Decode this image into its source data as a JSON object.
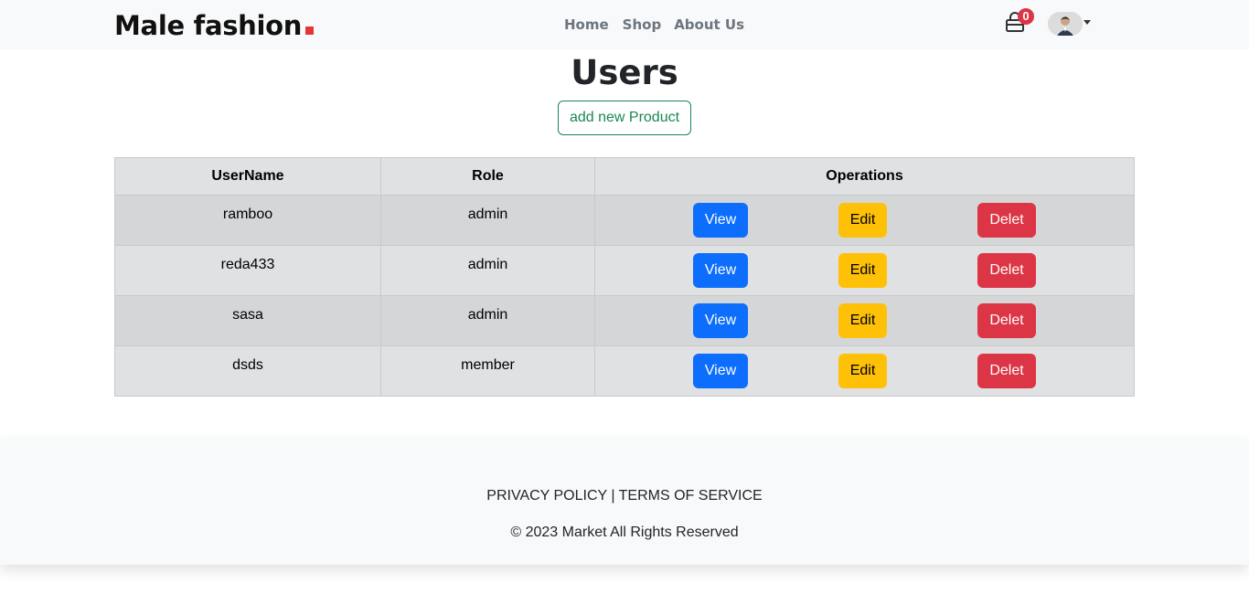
{
  "navbar": {
    "brand": "Male fashion",
    "links": [
      "Home",
      "Shop",
      "About Us"
    ],
    "cart_count": "0",
    "colors": {
      "accent": "#e53637",
      "badge": "#dc3545"
    }
  },
  "page": {
    "title": "Users",
    "add_button": "add new Product"
  },
  "table": {
    "headers": [
      "UserName",
      "Role",
      "Operations"
    ],
    "rows": [
      {
        "username": "ramboo",
        "role": "admin"
      },
      {
        "username": "reda433",
        "role": "admin"
      },
      {
        "username": "sasa",
        "role": "admin"
      },
      {
        "username": "dsds",
        "role": "member"
      }
    ],
    "actions": {
      "view": "View",
      "edit": "Edit",
      "delete": "Delet"
    },
    "colors": {
      "view": "#0d6efd",
      "edit": "#ffc107",
      "delete": "#dc3545"
    }
  },
  "footer": {
    "privacy": "PRIVACY POLICY",
    "separator": "|",
    "terms": "TERMS OF SERVICE",
    "copyright": "© 2023 Market All Rights Reserved"
  }
}
